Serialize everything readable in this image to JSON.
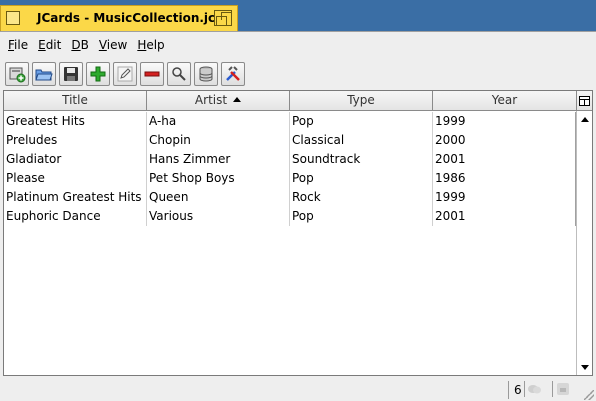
{
  "window": {
    "title": "JCards - MusicCollection.jca"
  },
  "menu": [
    {
      "label": "File",
      "mnemonic": "F",
      "rest": "ile"
    },
    {
      "label": "Edit",
      "mnemonic": "E",
      "rest": "dit"
    },
    {
      "label": "DB",
      "mnemonic": "D",
      "rest": "B"
    },
    {
      "label": "View",
      "mnemonic": "V",
      "rest": "iew"
    },
    {
      "label": "Help",
      "mnemonic": "H",
      "rest": "elp"
    }
  ],
  "toolbar": {
    "buttons": [
      {
        "icon": "new-database-icon"
      },
      {
        "icon": "open-folder-icon"
      },
      {
        "icon": "save-icon"
      },
      {
        "icon": "add-card-icon"
      },
      {
        "icon": "edit-card-icon"
      },
      {
        "icon": "remove-card-icon"
      },
      {
        "icon": "search-icon"
      },
      {
        "icon": "database-icon"
      },
      {
        "icon": "settings-tools-icon"
      }
    ]
  },
  "table": {
    "columns": [
      "Title",
      "Artist",
      "Type",
      "Year"
    ],
    "sorted_column": "Artist",
    "sort_direction": "ascending",
    "rows": [
      [
        "Greatest Hits",
        "A-ha",
        "Pop",
        "1999"
      ],
      [
        "Preludes",
        "Chopin",
        "Classical",
        "2000"
      ],
      [
        "Gladiator",
        "Hans Zimmer",
        "Soundtrack",
        "2001"
      ],
      [
        "Please",
        "Pet Shop Boys",
        "Pop",
        "1986"
      ],
      [
        "Platinum Greatest Hits",
        "Queen",
        "Rock",
        "1999"
      ],
      [
        "Euphoric Dance",
        "Various",
        "Pop",
        "2001"
      ]
    ]
  },
  "status": {
    "count": "6"
  }
}
